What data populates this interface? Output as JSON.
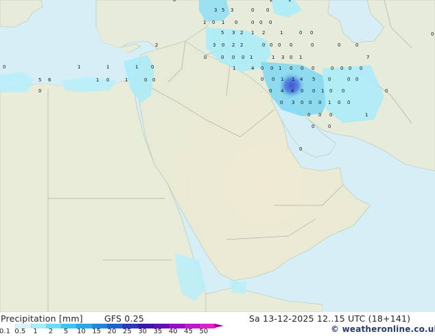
{
  "legend": {
    "title": "Precipitation [mm]",
    "model": "GFS 0.25",
    "datetime": "Sa 13-12-2025 12..15 UTC (18+141)",
    "credit": "© weatheronline.co.uk",
    "ticks": [
      "0.1",
      "0.5",
      "1",
      "2",
      "5",
      "10",
      "15",
      "20",
      "25",
      "30",
      "35",
      "40",
      "45",
      "50"
    ],
    "colors": [
      "#ffffff",
      "#d8f4fa",
      "#a6ecfa",
      "#6cdcf6",
      "#39c7ef",
      "#27a9e6",
      "#1e88dc",
      "#2160cf",
      "#2a38c0",
      "#3a18b0",
      "#6010b8",
      "#9010c8",
      "#c018d0",
      "#e020c8"
    ]
  },
  "map": {
    "sea_color": "#d7eef6",
    "land_color": "#e9eee0",
    "desert_color": "#eee9d5",
    "precip_max_color": "#3a4fd0",
    "values": [
      "3",
      "5",
      "3",
      "0",
      "0",
      "1",
      "2",
      "0",
      "1",
      "0",
      "1",
      "0",
      "0",
      "0",
      "0",
      "5",
      "3",
      "2",
      "1",
      "2",
      "1",
      "0",
      "0",
      "2",
      "3",
      "0",
      "2",
      "2",
      "0",
      "0",
      "0",
      "0",
      "0",
      "0",
      "0",
      "0",
      "0",
      "0",
      "0",
      "0",
      "1",
      "1",
      "3",
      "0",
      "1",
      "7",
      "0",
      "1",
      "1",
      "1",
      "0",
      "1",
      "4",
      "0",
      "0",
      "1",
      "0",
      "0",
      "0",
      "0",
      "0",
      "0",
      "0",
      "5",
      "6",
      "1",
      "0",
      "1",
      "0",
      "0",
      "0",
      "0",
      "1",
      "1",
      "4",
      "5",
      "0",
      "0",
      "0",
      "0",
      "0",
      "4",
      "4",
      "0",
      "0",
      "1",
      "0",
      "0",
      "0",
      "0",
      "3",
      "0",
      "0",
      "0",
      "1",
      "0",
      "0",
      "0",
      "0",
      "0",
      "1",
      "0",
      "0",
      "0"
    ]
  }
}
